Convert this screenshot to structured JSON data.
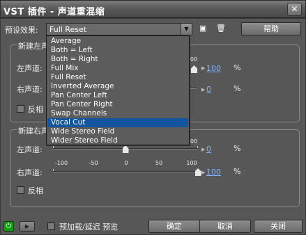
{
  "window": {
    "title": "VST 插件 - 声道重混缩",
    "close_label": "✕"
  },
  "preset": {
    "label": "预设效果:",
    "value": "Full Reset",
    "help_label": "帮助",
    "options": [
      "Average",
      "Both = Left",
      "Both = Right",
      "Full Mix",
      "Full Reset",
      "Inverted Average",
      "Pan Center Left",
      "Pan Center Right",
      "Swap Channels",
      "Vocal Cut",
      "Wide Stereo Field",
      "Wider Stereo Field"
    ],
    "selected_option": "Vocal Cut"
  },
  "left_group": {
    "title": "新建左声道",
    "left_label": "左声道:",
    "left_value": "100",
    "right_label": "右声道:",
    "right_value": "0",
    "invert_label": "反相",
    "pct": "%",
    "tick_label_right": "00"
  },
  "right_group": {
    "title": "新建右声道",
    "left_label": "左声道:",
    "left_value": "0",
    "right_label": "右声道:",
    "right_value": "100",
    "invert_label": "反相",
    "pct": "%",
    "tick_label_right": "00",
    "ticks": [
      "-100",
      "-50",
      "0",
      "50",
      "100"
    ],
    "left_level_pct": 0,
    "right_level_pct": 100
  },
  "footer": {
    "power_label": "⏻",
    "play_label": "▶",
    "preroll_label": "预加载/延迟 预览",
    "ok_label": "确定",
    "cancel_label": "取消",
    "close_label": "关闭"
  }
}
